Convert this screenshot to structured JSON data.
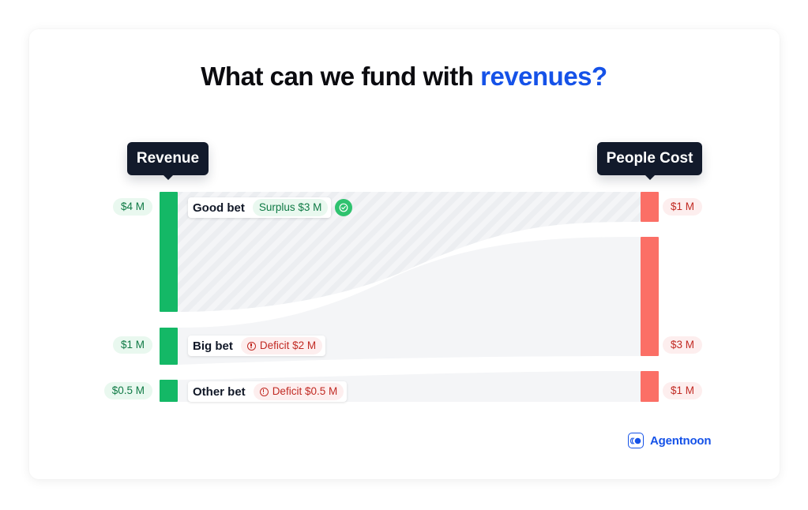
{
  "title": {
    "main": "What can we fund with ",
    "accent": "revenues?"
  },
  "colors": {
    "accent": "#1552e8",
    "revenue": "#14b866",
    "cost": "#fb6f66",
    "surplus_text": "#0f7a45",
    "deficit_text": "#c12a23"
  },
  "headers": {
    "left": "Revenue",
    "right": "People Cost"
  },
  "chart_data": {
    "type": "sankey",
    "title": "What can we fund with revenues?",
    "left_column": "Revenue",
    "right_column": "People Cost",
    "units": "$ M",
    "bets": [
      {
        "name": "Good bet",
        "revenue": 4,
        "revenue_label": "$4 M",
        "people_cost": 1,
        "people_cost_label": "$1 M",
        "status": "Surplus",
        "status_label": "Surplus $3 M",
        "balance": 3
      },
      {
        "name": "Big bet",
        "revenue": 1,
        "revenue_label": "$1 M",
        "people_cost": 3,
        "people_cost_label": "$3 M",
        "status": "Deficit",
        "status_label": "Deficit $2 M",
        "balance": -2
      },
      {
        "name": "Other bet",
        "revenue": 0.5,
        "revenue_label": "$0.5 M",
        "people_cost": 1,
        "people_cost_label": "$1 M",
        "status": "Deficit",
        "status_label": "Deficit $0.5 M",
        "balance": -0.5
      }
    ]
  },
  "brand": {
    "name": "Agentnoon",
    "icon": "agentnoon-logo-icon"
  },
  "icons": {
    "surplus": "check-circle-icon",
    "deficit": "alert-circle-icon"
  }
}
